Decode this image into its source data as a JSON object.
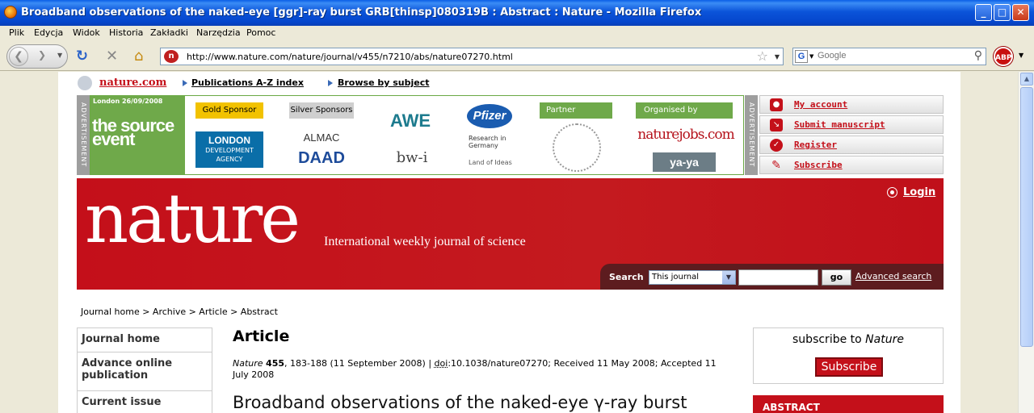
{
  "window": {
    "title": "Broadband observations of the naked-eye [ggr]-ray burst GRB[thinsp]080319B : Abstract : Nature - Mozilla Firefox",
    "min": "_",
    "max": "□",
    "close": "✕"
  },
  "menu": [
    "Plik",
    "Edycja",
    "Widok",
    "Historia",
    "Zakładki",
    "Narzędzia",
    "Pomoc"
  ],
  "toolbar": {
    "url": "http://www.nature.com/nature/journal/v455/n7210/abs/nature07270.html",
    "search_placeholder": "Google",
    "abp": "ABP"
  },
  "site_nav": {
    "brand": "nature.com",
    "links": [
      "Publications A-Z index",
      "Browse by subject"
    ]
  },
  "advert": {
    "label": "ADVERTISEMENT",
    "date": "London 26/09/2008",
    "event": "the source event",
    "gold_sponsor": "Gold Sponsor",
    "silver_sponsors": "Silver Sponsors",
    "partner": "Partner",
    "organised_by": "Organised by",
    "logos": {
      "london1": "LONDON",
      "london2": "DEVELOPMENT",
      "london3": "AGENCY",
      "almac": "ALMAC",
      "daad": "DAAD",
      "awe": "AWE",
      "bwi": "bw-i",
      "pfizer": "Pfizer",
      "research": "Research in Germany",
      "ideas": "Land of Ideas",
      "naturejobs": "naturejobs.com",
      "yaya": "ya-ya"
    }
  },
  "user_menu": [
    {
      "label": "My account",
      "icon": "user-icon"
    },
    {
      "label": "Submit manuscript",
      "icon": "submit-icon"
    },
    {
      "label": "Register",
      "icon": "register-icon"
    },
    {
      "label": "Subscribe",
      "icon": "pencil-icon"
    }
  ],
  "masthead": {
    "logo": "nature",
    "tagline": "International weekly journal of science",
    "login": "Login",
    "search_label": "Search",
    "search_scope": "This journal",
    "go": "go",
    "advanced": "Advanced search"
  },
  "breadcrumb": "Journal home > Archive > Article > Abstract",
  "left_nav": [
    "Journal home",
    "Advance online publication",
    "Current issue"
  ],
  "article": {
    "heading": "Article",
    "journal": "Nature",
    "volume": "455",
    "pages": ", 183-188 (11 September 2008) | ",
    "doi_label": "doi",
    "doi_rest": ":10.1038/nature07270; Received 11 May 2008; Accepted 11 July 2008",
    "title": "Broadband observations of the naked-eye γ-ray burst"
  },
  "subscribe_box": {
    "text": "subscribe to ",
    "journal": "Nature",
    "button": "Subscribe"
  },
  "abstract_label": "ABSTRACT",
  "colors": {
    "nature_red": "#c4101a",
    "sponsor_green": "#6fa94a"
  }
}
